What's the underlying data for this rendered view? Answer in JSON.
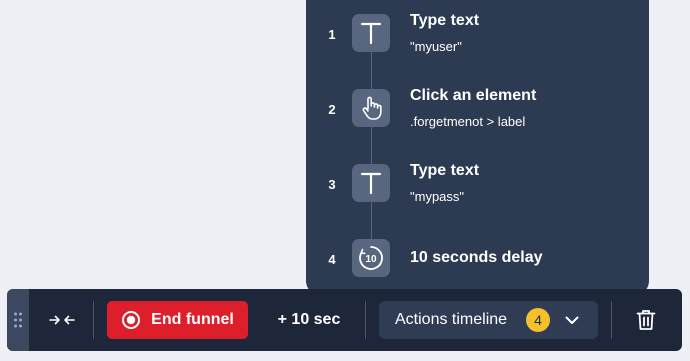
{
  "timeline": {
    "steps": [
      {
        "number": "1",
        "icon": "text-icon",
        "title": "Type text",
        "subtitle": "\"myuser\""
      },
      {
        "number": "2",
        "icon": "click-pointer-icon",
        "title": "Click an element",
        "subtitle": ".forgetmenot > label"
      },
      {
        "number": "3",
        "icon": "text-icon",
        "title": "Type text",
        "subtitle": "\"mypass\""
      },
      {
        "number": "4",
        "icon": "delay-timer-icon",
        "title": "10 seconds delay",
        "icon_text": "10"
      }
    ]
  },
  "toolbar": {
    "end_funnel_label": "End funnel",
    "add_time_label": "+ 10 sec",
    "actions_timeline_label": "Actions timeline",
    "actions_count": "4",
    "icons": {
      "drag": "drag-handle-icon",
      "collapse": "collapse-arrows-icon",
      "record": "record-icon",
      "chevron": "chevron-down-icon",
      "delete": "trash-icon"
    }
  },
  "colors": {
    "page_background": "#eef0f5",
    "panel": "#2c3a52",
    "toolbar": "#1e2739",
    "icon_tile": "#58677f",
    "end_button": "#dd1f2b",
    "badge": "#f5c12a"
  }
}
